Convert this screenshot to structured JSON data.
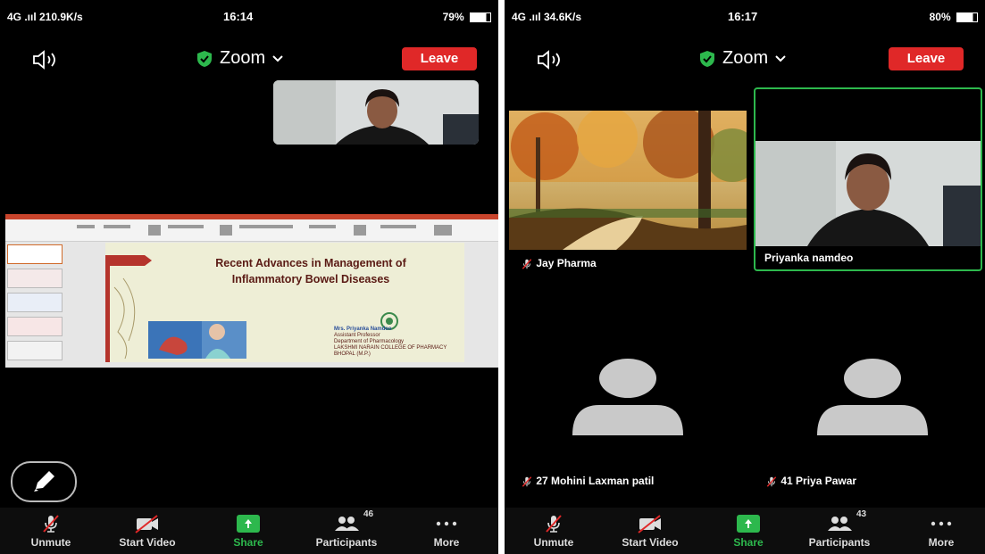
{
  "left": {
    "status": {
      "network": "4G .ııl 210.9K/s",
      "time": "16:14",
      "battery": "79%"
    },
    "meeting_title": "Zoom",
    "leave_label": "Leave",
    "slide": {
      "title_line1": "Recent Advances in Management of",
      "title_line2": "Inflammatory Bowel Diseases",
      "author": "Mrs. Priyanka Namdeo",
      "role": "Assistant Professor",
      "department": "Department of Pharmacology",
      "college": "LAKSHMI NARAIN COLLEGE OF PHARMACY",
      "city": "BHOPAL (M.P.)"
    },
    "toolbar": {
      "unmute": "Unmute",
      "start_video": "Start Video",
      "share": "Share",
      "participants": "Participants",
      "participants_count": "46",
      "more": "More"
    }
  },
  "right": {
    "status": {
      "network": "4G .ııl 34.6K/s",
      "time": "16:17",
      "battery": "80%"
    },
    "meeting_title": "Zoom",
    "leave_label": "Leave",
    "participants": [
      {
        "name": "Jay Pharma"
      },
      {
        "name": "Priyanka namdeo"
      },
      {
        "name": "27 Mohini Laxman patil"
      },
      {
        "name": "41 Priya Pawar"
      }
    ],
    "toolbar": {
      "unmute": "Unmute",
      "start_video": "Start Video",
      "share": "Share",
      "participants": "Participants",
      "participants_count": "43",
      "more": "More"
    }
  },
  "colors": {
    "leave": "#e02828",
    "share": "#2db84d",
    "active_border": "#2db84d",
    "shield": "#2db84d"
  }
}
